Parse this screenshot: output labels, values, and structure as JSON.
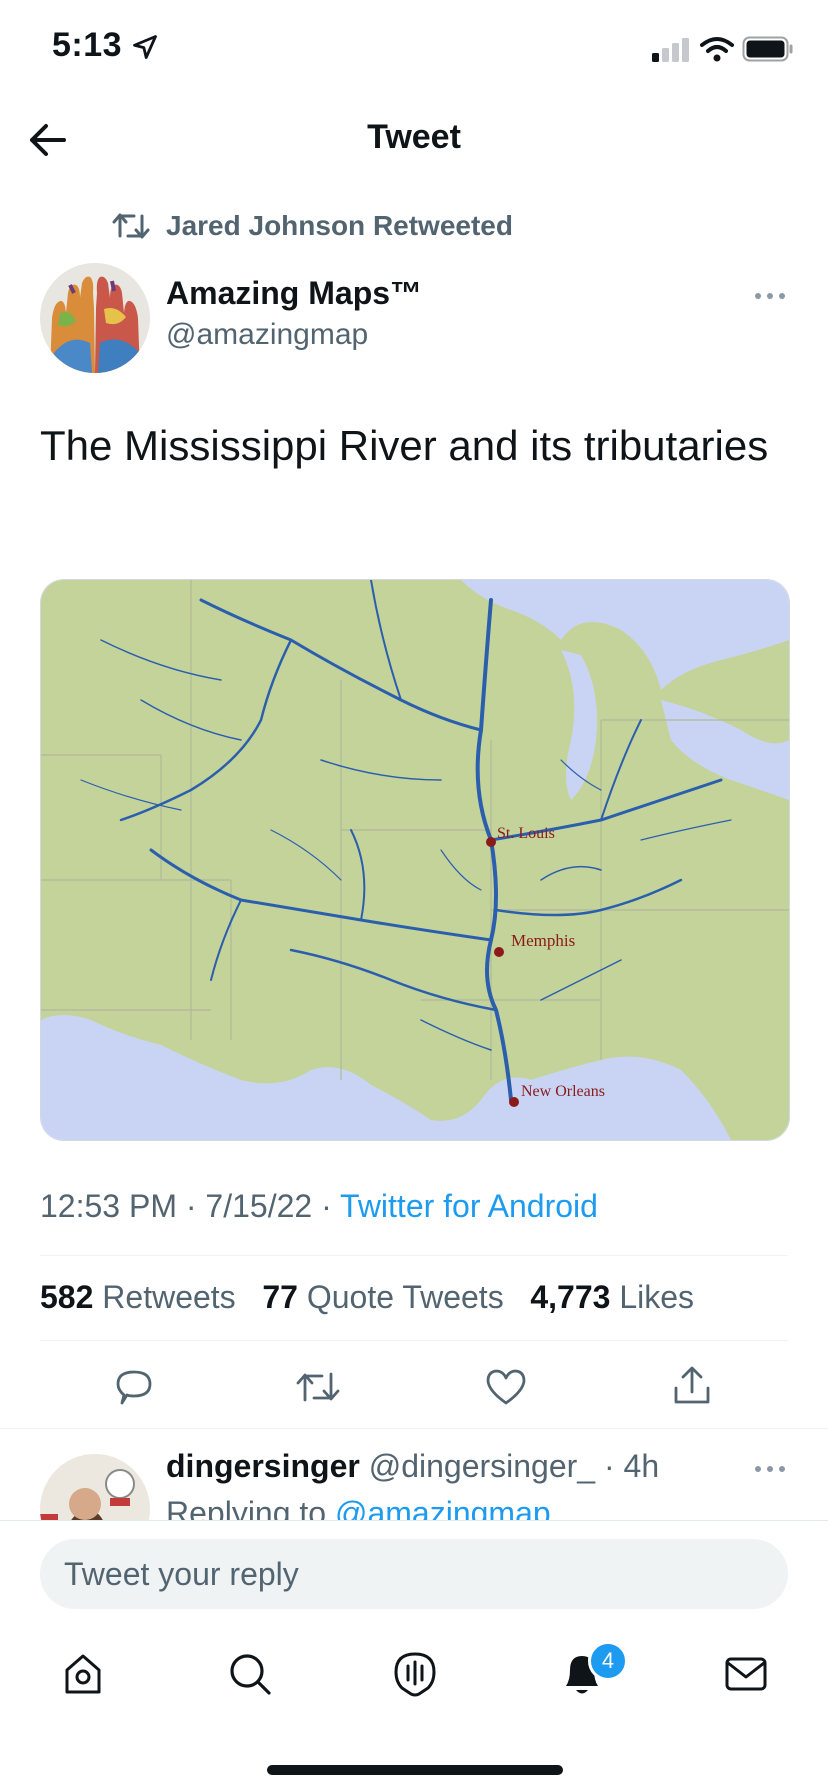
{
  "status_bar": {
    "time": "5:13"
  },
  "header": {
    "title": "Tweet"
  },
  "retweet": {
    "label": "Jared Johnson Retweeted"
  },
  "author": {
    "name": "Amazing Maps™",
    "handle": "@amazingmap"
  },
  "tweet": {
    "text": "The Mississippi River and its tributaries"
  },
  "media": {
    "cities": [
      "St. Louis",
      "Memphis",
      "New Orleans"
    ]
  },
  "meta": {
    "time": "12:53 PM",
    "sep1": " · ",
    "date": "7/15/22",
    "sep2": " · ",
    "source": "Twitter for Android"
  },
  "stats": {
    "retweets_count": "582",
    "retweets_label": "Retweets",
    "quotes_count": "77",
    "quotes_label": "Quote Tweets",
    "likes_count": "4,773",
    "likes_label": "Likes"
  },
  "reply": {
    "name": "dingersinger",
    "handle": "@dingersinger_ · 4h",
    "replying_prefix": "Replying to ",
    "replying_to": "@amazingmap"
  },
  "compose": {
    "placeholder": "Tweet your reply"
  },
  "tabbar": {
    "notifications_badge": "4"
  },
  "colors": {
    "accent": "#1d9bf0",
    "text": "#0f1419",
    "muted": "#536471",
    "map_land": "#c4d39a",
    "map_water": "#c9d4f5",
    "river": "#2b5fae"
  }
}
